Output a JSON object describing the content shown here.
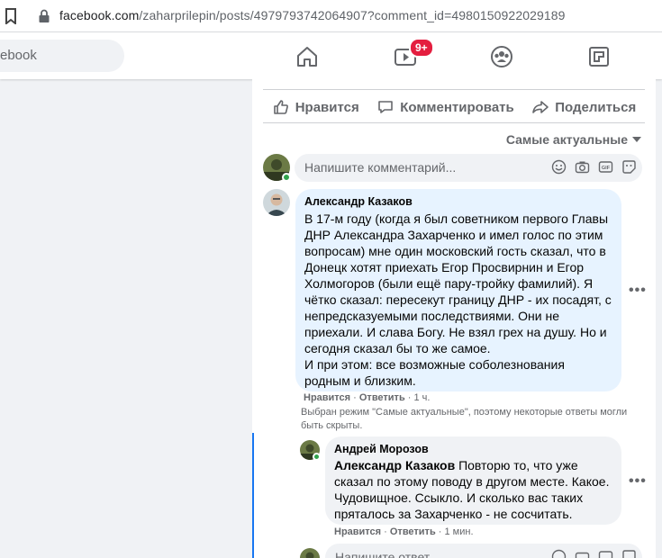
{
  "browser": {
    "url_host": "facebook.com",
    "url_path": "/zaharprilepin/posts/4979793742064907?comment_id=4980150922029189"
  },
  "header": {
    "search_placeholder": "ebook",
    "video_badge": "9+"
  },
  "actions": {
    "like": "Нравится",
    "comment": "Комментировать",
    "share": "Поделиться"
  },
  "sort_label": "Самые актуальные",
  "composer": {
    "placeholder": "Напишите комментарий..."
  },
  "comments": [
    {
      "author": "Александр Казаков",
      "text": "В 17-м году (когда я был советником первого Главы ДНР Александра Захарченко и имел голос по этим вопросам) мне один московский гость сказал, что в Донецк хотят приехать Егор Просвирнин и Егор Холмогоров (были ещё пару-тройку фамилий). Я чётко сказал: пересекут границу ДНР - их посадят, с непредсказуемыми последствиями. Они не приехали. И слава Богу. Не взял грех на душу. Но и сегодня сказал бы то же самое.\nИ при этом: все возможные соболезнования родным и близким.",
      "like": "Нравится",
      "reply": "Ответить",
      "time": "1 ч."
    }
  ],
  "note": "Выбран режим \"Самые актуальные\", поэтому некоторые ответы могли быть скрыты.",
  "reply": {
    "author": "Андрей Морозов",
    "mention": "Александр Казаков",
    "text": "Повторю то, что уже сказал по этому поводу в другом месте. Какое. Чудовищное. Ссыкло. И сколько вас таких пряталось за Захарченко - не сосчитать.",
    "like": "Нравится",
    "reply": "Ответить",
    "time": "1 мин."
  },
  "reply_composer": {
    "placeholder": "Напишите ответ..."
  },
  "colors": {
    "accent": "#1877f2",
    "badge": "#e41e3f",
    "bubble": "#e7f3ff"
  }
}
